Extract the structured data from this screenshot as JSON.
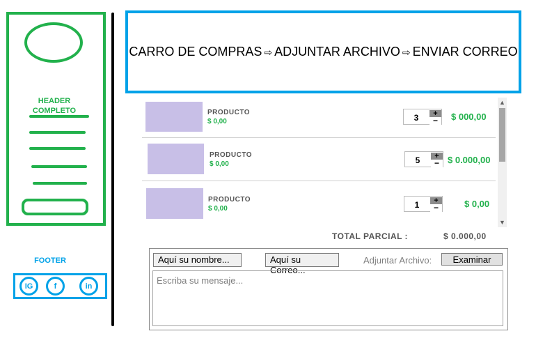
{
  "header": {
    "label_line1": "HEADER",
    "label_line2": "COMPLETO"
  },
  "footer": {
    "label": "FOOTER",
    "social": [
      {
        "label": "IG",
        "icon": "instagram-icon"
      },
      {
        "label": "f",
        "icon": "facebook-icon"
      },
      {
        "label": "in",
        "icon": "linkedin-icon"
      }
    ]
  },
  "steps": {
    "step1": "CARRO DE COMPRAS",
    "step2": "ADJUNTAR ARCHIVO",
    "step3": "ENVIAR CORREO",
    "arrow": "⇨"
  },
  "cart": {
    "items": [
      {
        "name": "PRODUCTO",
        "price": "$ 0,00",
        "qty": "3",
        "total": "$ 000,00"
      },
      {
        "name": "PRODUCTO",
        "price": "$ 0,00",
        "qty": "5",
        "total": "$ 0.000,00"
      },
      {
        "name": "PRODUCTO",
        "price": "$ 0,00",
        "qty": "1",
        "total": "$ 0,00"
      }
    ],
    "plus": "+",
    "minus": "−",
    "subtotal_label": "TOTAL PARCIAL :",
    "subtotal_value": "$ 0.000,00"
  },
  "form": {
    "name_field": "Aquí su nombre...",
    "email_field": "Aquí su Correo...",
    "attach_label": "Adjuntar Archivo:",
    "browse_button": "Examinar",
    "message_placeholder": "Escriba su mensaje..."
  },
  "colors": {
    "green": "#22b14c",
    "blue": "#00a2e8",
    "thumb": "#c8bfe7"
  }
}
